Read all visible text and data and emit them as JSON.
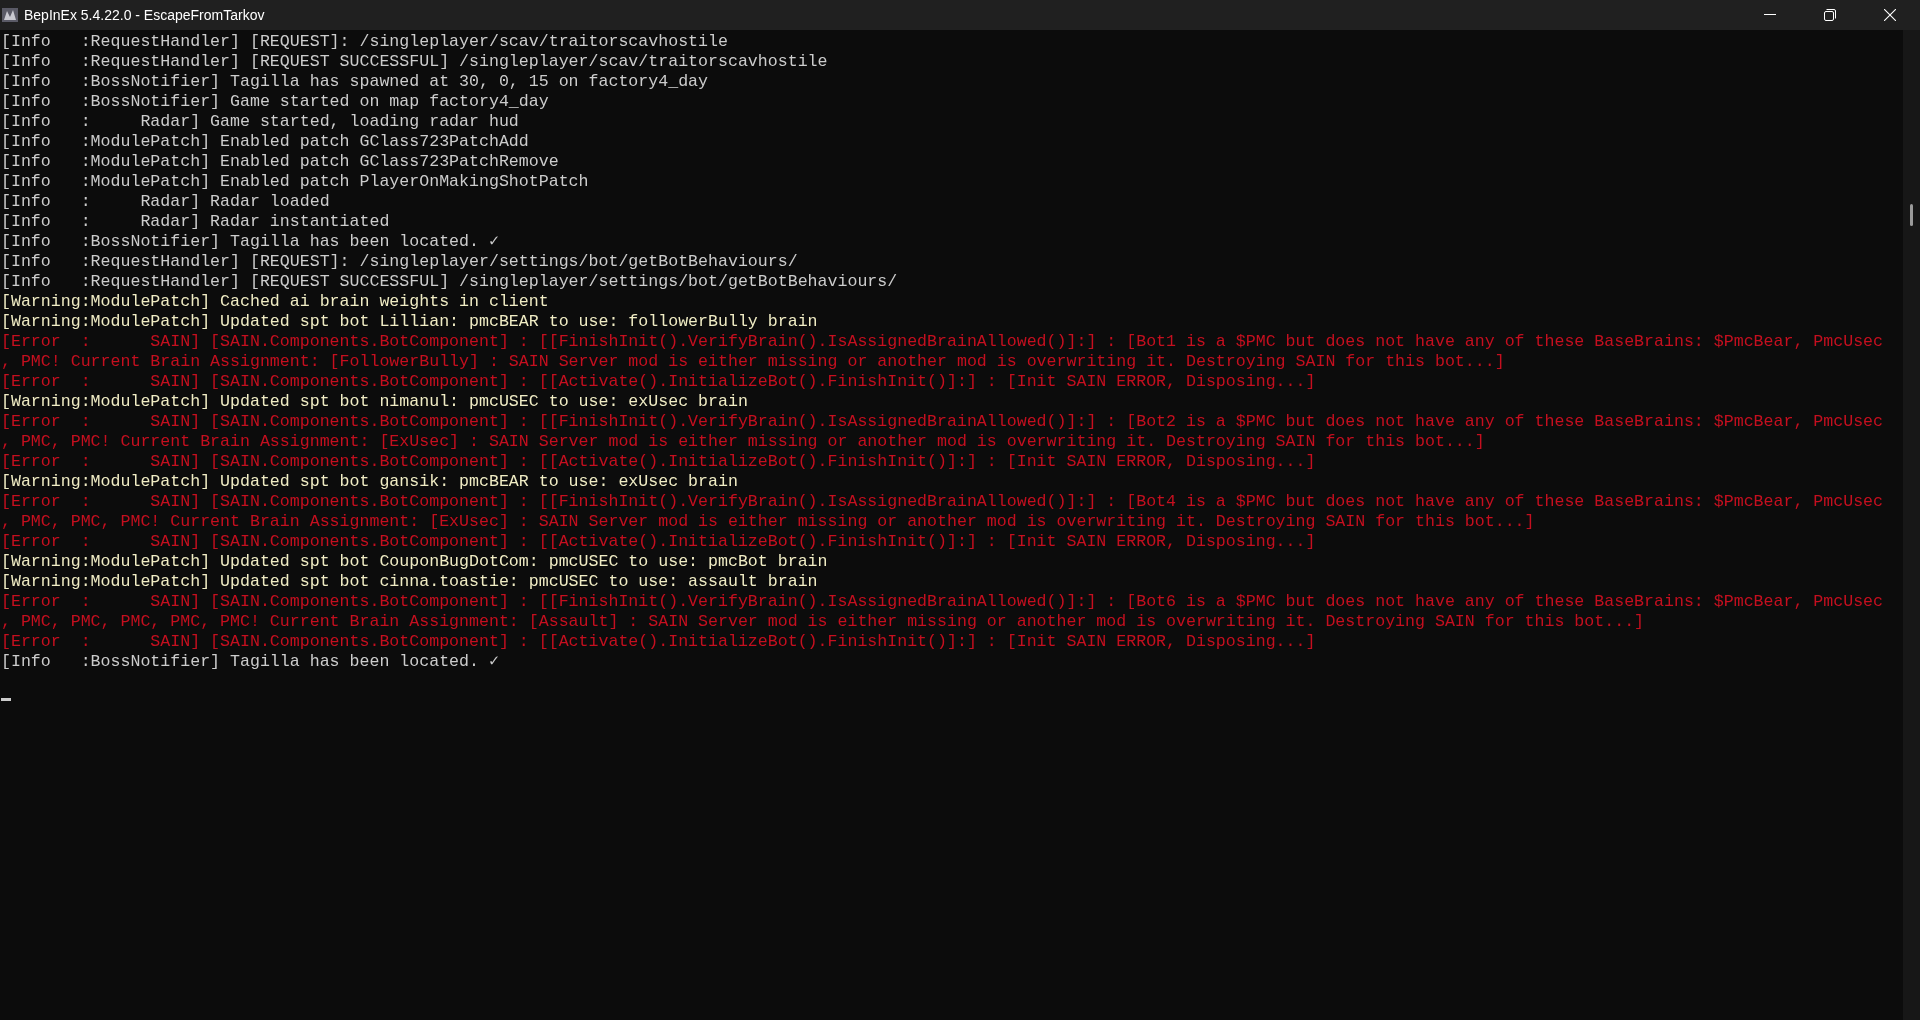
{
  "window": {
    "title": "BepInEx 5.4.22.0 - EscapeFromTarkov"
  },
  "console_lines": [
    {
      "kind": "info",
      "text": "[Info   :RequestHandler] [REQUEST]: /singleplayer/scav/traitorscavhostile"
    },
    {
      "kind": "info",
      "text": "[Info   :RequestHandler] [REQUEST SUCCESSFUL] /singleplayer/scav/traitorscavhostile"
    },
    {
      "kind": "info",
      "text": "[Info   :BossNotifier] Tagilla has spawned at 30, 0, 15 on factory4_day"
    },
    {
      "kind": "info",
      "text": "[Info   :BossNotifier] Game started on map factory4_day"
    },
    {
      "kind": "info",
      "text": "[Info   :     Radar] Game started, loading radar hud"
    },
    {
      "kind": "info",
      "text": "[Info   :ModulePatch] Enabled patch GClass723PatchAdd"
    },
    {
      "kind": "info",
      "text": "[Info   :ModulePatch] Enabled patch GClass723PatchRemove"
    },
    {
      "kind": "info",
      "text": "[Info   :ModulePatch] Enabled patch PlayerOnMakingShotPatch"
    },
    {
      "kind": "info",
      "text": "[Info   :     Radar] Radar loaded"
    },
    {
      "kind": "info",
      "text": "[Info   :     Radar] Radar instantiated"
    },
    {
      "kind": "info",
      "text": "[Info   :BossNotifier] Tagilla has been located. ✓"
    },
    {
      "kind": "info",
      "text": "[Info   :RequestHandler] [REQUEST]: /singleplayer/settings/bot/getBotBehaviours/"
    },
    {
      "kind": "info",
      "text": "[Info   :RequestHandler] [REQUEST SUCCESSFUL] /singleplayer/settings/bot/getBotBehaviours/"
    },
    {
      "kind": "warning",
      "text": "[Warning:ModulePatch] Cached ai brain weights in client"
    },
    {
      "kind": "warning",
      "text": "[Warning:ModulePatch] Updated spt bot Lillian: pmcBEAR to use: followerBully brain"
    },
    {
      "kind": "error",
      "text": "[Error  :      SAIN] [SAIN.Components.BotComponent] : [[FinishInit().VerifyBrain().IsAssignedBrainAllowed()]:] : [Bot1 is a $PMC but does not have any of these BaseBrains: $PmcBear, PmcUsec"
    },
    {
      "kind": "error",
      "text": ", PMC! Current Brain Assignment: [FollowerBully] : SAIN Server mod is either missing or another mod is overwriting it. Destroying SAIN for this bot...]"
    },
    {
      "kind": "error",
      "text": "[Error  :      SAIN] [SAIN.Components.BotComponent] : [[Activate().InitializeBot().FinishInit()]:] : [Init SAIN ERROR, Disposing...]"
    },
    {
      "kind": "warning",
      "text": "[Warning:ModulePatch] Updated spt bot nimanul: pmcUSEC to use: exUsec brain"
    },
    {
      "kind": "error",
      "text": "[Error  :      SAIN] [SAIN.Components.BotComponent] : [[FinishInit().VerifyBrain().IsAssignedBrainAllowed()]:] : [Bot2 is a $PMC but does not have any of these BaseBrains: $PmcBear, PmcUsec"
    },
    {
      "kind": "error",
      "text": ", PMC, PMC! Current Brain Assignment: [ExUsec] : SAIN Server mod is either missing or another mod is overwriting it. Destroying SAIN for this bot...]"
    },
    {
      "kind": "error",
      "text": "[Error  :      SAIN] [SAIN.Components.BotComponent] : [[Activate().InitializeBot().FinishInit()]:] : [Init SAIN ERROR, Disposing...]"
    },
    {
      "kind": "warning",
      "text": "[Warning:ModulePatch] Updated spt bot gansik: pmcBEAR to use: exUsec brain"
    },
    {
      "kind": "error",
      "text": "[Error  :      SAIN] [SAIN.Components.BotComponent] : [[FinishInit().VerifyBrain().IsAssignedBrainAllowed()]:] : [Bot4 is a $PMC but does not have any of these BaseBrains: $PmcBear, PmcUsec"
    },
    {
      "kind": "error",
      "text": ", PMC, PMC, PMC! Current Brain Assignment: [ExUsec] : SAIN Server mod is either missing or another mod is overwriting it. Destroying SAIN for this bot...]"
    },
    {
      "kind": "error",
      "text": "[Error  :      SAIN] [SAIN.Components.BotComponent] : [[Activate().InitializeBot().FinishInit()]:] : [Init SAIN ERROR, Disposing...]"
    },
    {
      "kind": "warning",
      "text": "[Warning:ModulePatch] Updated spt bot CouponBugDotCom: pmcUSEC to use: pmcBot brain"
    },
    {
      "kind": "warning",
      "text": "[Warning:ModulePatch] Updated spt bot cinna.toastie: pmcUSEC to use: assault brain"
    },
    {
      "kind": "error",
      "text": "[Error  :      SAIN] [SAIN.Components.BotComponent] : [[FinishInit().VerifyBrain().IsAssignedBrainAllowed()]:] : [Bot6 is a $PMC but does not have any of these BaseBrains: $PmcBear, PmcUsec"
    },
    {
      "kind": "error",
      "text": ", PMC, PMC, PMC, PMC, PMC! Current Brain Assignment: [Assault] : SAIN Server mod is either missing or another mod is overwriting it. Destroying SAIN for this bot...]"
    },
    {
      "kind": "error",
      "text": "[Error  :      SAIN] [SAIN.Components.BotComponent] : [[Activate().InitializeBot().FinishInit()]:] : [Init SAIN ERROR, Disposing...]"
    },
    {
      "kind": "info",
      "text": "[Info   :BossNotifier] Tagilla has been located. ✓"
    }
  ]
}
